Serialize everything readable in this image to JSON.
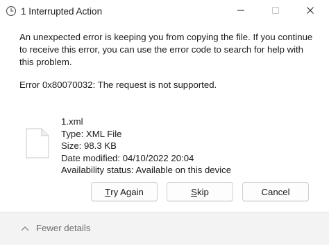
{
  "window": {
    "title": "1 Interrupted Action",
    "icons": {
      "app": "clock-icon",
      "minimize": "minimize-icon",
      "maximize": "maximize-icon",
      "close": "close-icon"
    }
  },
  "dialog": {
    "message": "An unexpected error is keeping you from copying the file. If you continue to receive this error, you can use the error code to search for help with this problem.",
    "error_code": "Error 0x80070032: The request is not supported."
  },
  "file": {
    "icon": "document-icon",
    "name": "1.xml",
    "type": "Type: XML File",
    "size": "Size: 98.3 KB",
    "date_modified": "Date modified: 04/10/2022 20:04",
    "availability": "Availability status: Available on this device"
  },
  "buttons": {
    "try_again": {
      "mnemonic": "T",
      "rest": "ry Again"
    },
    "skip": {
      "mnemonic": "S",
      "rest": "kip"
    },
    "cancel": "Cancel"
  },
  "footer": {
    "toggle_icon": "chevron-up-icon",
    "fewer_details": "Fewer details"
  },
  "colors": {
    "footer_bg": "#f3f3f3",
    "footer_text": "#6e6e6e",
    "button_border": "#cfcfcf"
  }
}
